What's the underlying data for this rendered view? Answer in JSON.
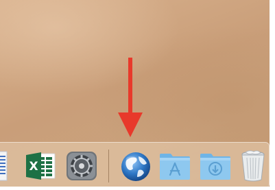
{
  "desktop": {
    "wallpaper": "desert sand"
  },
  "annotation": {
    "arrow_color": "#e8392b",
    "points_to": "globe-icon"
  },
  "dock": {
    "items": [
      {
        "icon": "text-document-icon",
        "app": ""
      },
      {
        "icon": "excel-icon",
        "letter": "X"
      },
      {
        "icon": "system-preferences-gear-icon",
        "app": ""
      },
      {
        "icon": "globe-icon",
        "app": ""
      },
      {
        "icon": "applications-folder-icon",
        "app": ""
      },
      {
        "icon": "downloads-folder-icon",
        "app": ""
      },
      {
        "icon": "trash-icon",
        "app": ""
      }
    ]
  },
  "colors": {
    "excel_green": "#1e7145",
    "folder_blue": "#8ec8ef",
    "globe_blue": "#2f78c6"
  }
}
